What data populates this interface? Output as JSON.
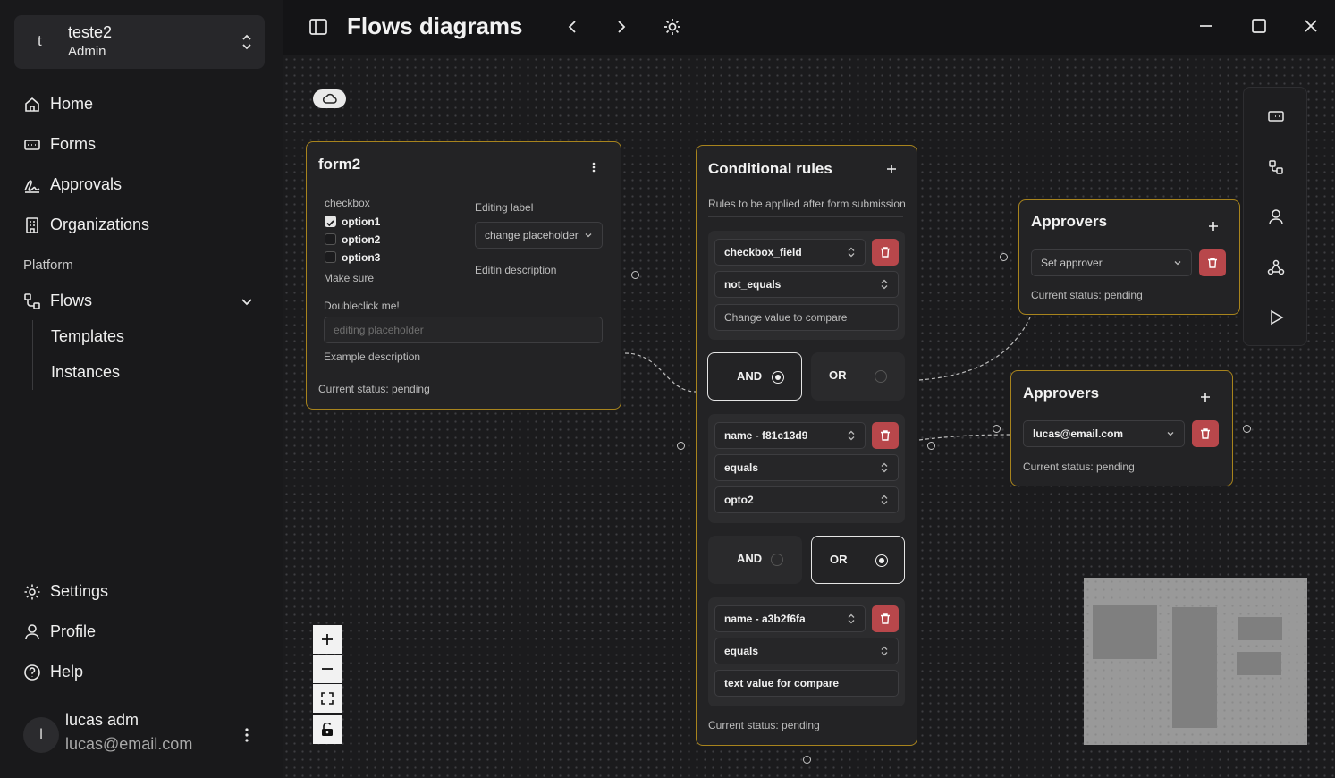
{
  "sidebar": {
    "org": {
      "avatar": "t",
      "name": "teste2",
      "role": "Admin"
    },
    "nav": [
      {
        "label": "Home",
        "icon": "home-icon"
      },
      {
        "label": "Forms",
        "icon": "forms-icon"
      },
      {
        "label": "Approvals",
        "icon": "signature-icon"
      },
      {
        "label": "Organizations",
        "icon": "building-icon"
      }
    ],
    "section": "Platform",
    "flows": {
      "label": "Flows",
      "icon": "workflow-icon",
      "children": [
        "Templates",
        "Instances"
      ]
    },
    "bottom": [
      {
        "label": "Settings",
        "icon": "gear-icon"
      },
      {
        "label": "Profile",
        "icon": "user-icon"
      },
      {
        "label": "Help",
        "icon": "help-icon"
      }
    ],
    "user": {
      "avatar": "l",
      "name": "lucas adm",
      "email": "lucas@email.com"
    }
  },
  "header": {
    "title": "Flows diagrams"
  },
  "form_node": {
    "title": "form2",
    "checkbox_label": "checkbox",
    "options": [
      {
        "label": "option1",
        "checked": true
      },
      {
        "label": "option2",
        "checked": false
      },
      {
        "label": "option3",
        "checked": false
      }
    ],
    "checkbox_desc": "Make sure",
    "editing_label": "Editing label",
    "select_placeholder": "change placeholder",
    "editing_desc": "Editin description",
    "text_label": "Doubleclick me!",
    "text_placeholder": "editing placeholder",
    "text_desc": "Example description",
    "status": "Current status: pending"
  },
  "rules_node": {
    "title": "Conditional rules",
    "subtitle": "Rules to be applied after form submission",
    "groups": [
      {
        "field": "checkbox_field",
        "operator": "not_equals",
        "value": "Change value to compare",
        "value_is_placeholder": true
      },
      {
        "field": "name - f81c13d9",
        "operator": "equals",
        "value": "opto2",
        "value_is_placeholder": false
      },
      {
        "field": "name - a3b2f6fa",
        "operator": "equals",
        "value": "text value for compare",
        "value_is_placeholder": false
      }
    ],
    "logic": [
      {
        "and": "AND",
        "or": "OR",
        "selected": "AND"
      },
      {
        "and": "AND",
        "or": "OR",
        "selected": "OR"
      }
    ],
    "status": "Current status: pending"
  },
  "approvers_1": {
    "title": "Approvers",
    "select": "Set approver",
    "status": "Current status: pending"
  },
  "approvers_2": {
    "title": "Approvers",
    "select": "lucas@email.com",
    "status": "Current status: pending"
  },
  "colors": {
    "node_border": "#a8841d",
    "danger": "#b8474b",
    "bg": "#141416"
  }
}
